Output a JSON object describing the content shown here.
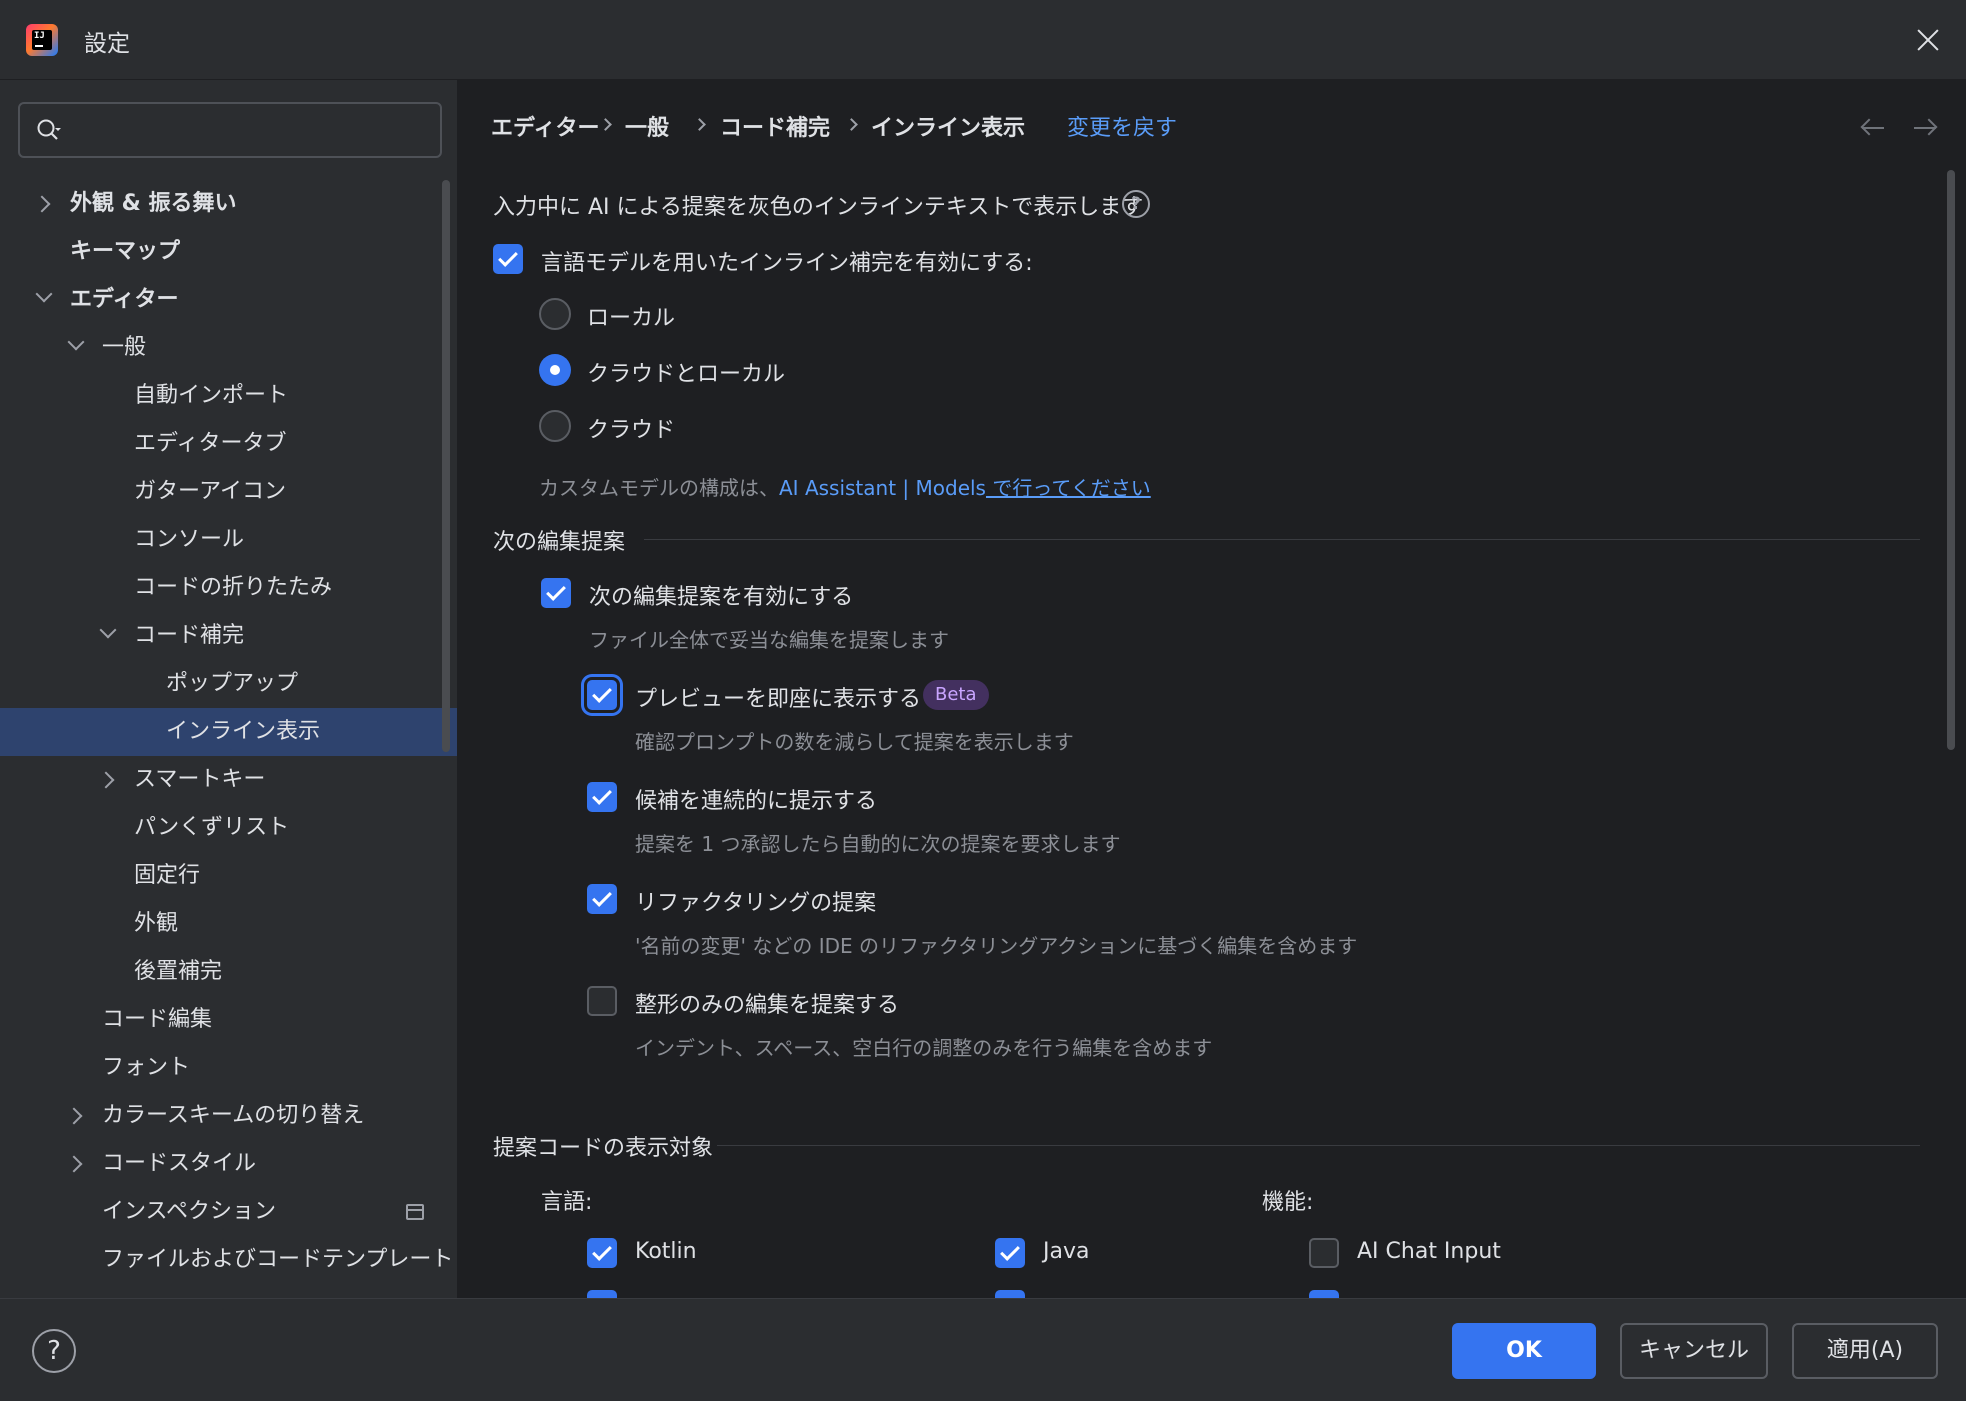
{
  "window": {
    "title": "設定",
    "accent_color": "#3574f0",
    "selection_color": "#2e436e",
    "link_color": "#5a9cf8"
  },
  "search": {
    "placeholder": "",
    "value": ""
  },
  "sidebar": {
    "items": [
      {
        "label": "外観 & 振る舞い"
      },
      {
        "label": "キーマップ"
      },
      {
        "label": "エディター"
      },
      {
        "label": "一般"
      },
      {
        "label": "自動インポート"
      },
      {
        "label": "エディタータブ"
      },
      {
        "label": "ガターアイコン"
      },
      {
        "label": "コンソール"
      },
      {
        "label": "コードの折りたたみ"
      },
      {
        "label": "コード補完"
      },
      {
        "label": "ポップアップ"
      },
      {
        "label": "インライン表示"
      },
      {
        "label": "スマートキー"
      },
      {
        "label": "パンくずリスト"
      },
      {
        "label": "固定行"
      },
      {
        "label": "外観"
      },
      {
        "label": "後置補完"
      },
      {
        "label": "コード編集"
      },
      {
        "label": "フォント"
      },
      {
        "label": "カラースキームの切り替え"
      },
      {
        "label": "コードスタイル"
      },
      {
        "label": "インスペクション"
      },
      {
        "label": "ファイルおよびコードテンプレート"
      }
    ]
  },
  "breadcrumb": {
    "items": [
      "エディター",
      "一般",
      "コード補完",
      "インライン表示"
    ],
    "revert": "変更を戻す"
  },
  "main": {
    "intro": "入力中に AI による提案を灰色のインラインテキストで表示します",
    "enable_llm": "言語モデルを用いたインライン補完を有効にする:",
    "radio_local": "ローカル",
    "radio_cloud_local": "クラウドとローカル",
    "radio_cloud": "クラウド",
    "custom_prefix": "カスタムモデルの構成は、",
    "custom_link": "AI Assistant | Models",
    "custom_suffix": " で行ってください",
    "next_edit_section": "次の編集提案",
    "enable_next_edit": "次の編集提案を有効にする",
    "enable_next_edit_hint": "ファイル全体で妥当な編集を提案します",
    "preview_now": "プレビューを即座に表示する",
    "beta": "Beta",
    "preview_now_hint": "確認プロンプトの数を減らして提案を表示します",
    "continuous": "候補を連続的に提示する",
    "continuous_hint": "提案を 1 つ承認したら自動的に次の提案を要求します",
    "refactoring": "リファクタリングの提案",
    "refactoring_hint": "'名前の変更' などの IDE のリファクタリングアクションに基づく編集を含めます",
    "format_only": "整形のみの編集を提案する",
    "format_only_hint": "インデント、スペース、空白行の調整のみを行う編集を含めます",
    "targets_section": "提案コードの表示対象",
    "languages_label": "言語:",
    "features_label": "機能:",
    "lang_kotlin": "Kotlin",
    "lang_java": "Java",
    "feature_ai_chat": "AI Chat Input"
  },
  "footer": {
    "help": "?",
    "ok": "OK",
    "cancel": "キャンセル",
    "apply": "適用(A)"
  }
}
